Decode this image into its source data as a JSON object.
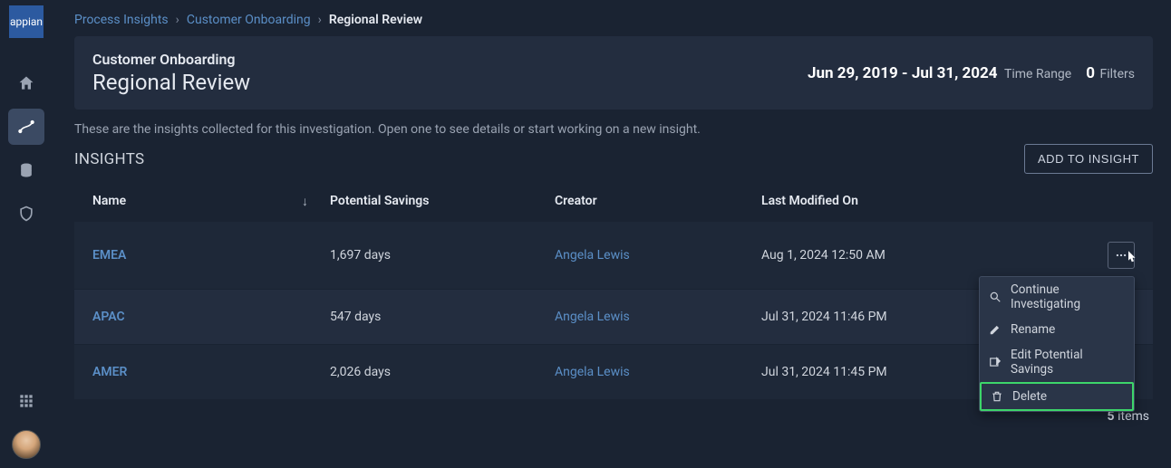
{
  "logo_text": "appian",
  "breadcrumb": {
    "items": [
      "Process Insights",
      "Customer Onboarding"
    ],
    "current": "Regional Review"
  },
  "header": {
    "subtitle": "Customer Onboarding",
    "title": "Regional Review",
    "time_range_value": "Jun 29, 2019 - Jul 31, 2024",
    "time_range_label": "Time Range",
    "filters_count": "0",
    "filters_label": "Filters"
  },
  "description": "These are the insights collected for this investigation. Open one to see details or start working on a new insight.",
  "section_title": "INSIGHTS",
  "add_button": "ADD TO INSIGHT",
  "columns": {
    "name": "Name",
    "savings": "Potential Savings",
    "creator": "Creator",
    "modified": "Last Modified On"
  },
  "rows": [
    {
      "name": "EMEA",
      "savings": "1,697 days",
      "creator": "Angela Lewis",
      "modified": "Aug 1, 2024 12:50 AM"
    },
    {
      "name": "APAC",
      "savings": "547 days",
      "creator": "Angela Lewis",
      "modified": "Jul 31, 2024 11:46 PM"
    },
    {
      "name": "AMER",
      "savings": "2,026 days",
      "creator": "Angela Lewis",
      "modified": "Jul 31, 2024 11:45 PM"
    }
  ],
  "footer": {
    "count": "5",
    "label": "items"
  },
  "context_menu": {
    "continue": "Continue Investigating",
    "rename": "Rename",
    "edit": "Edit Potential Savings",
    "delete": "Delete"
  }
}
